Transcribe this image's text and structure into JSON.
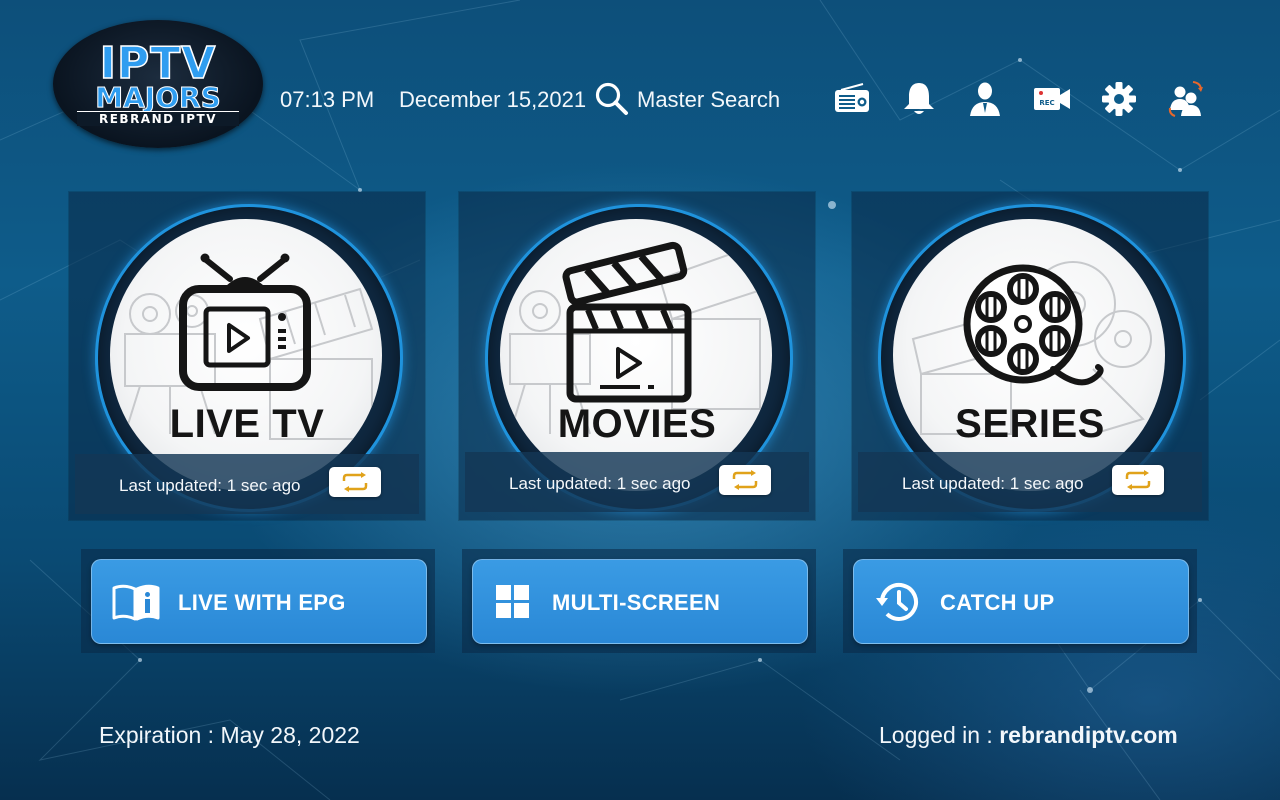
{
  "brand": {
    "line1": "IPTV",
    "line2": "MAJORS",
    "line3": "REBRAND IPTV"
  },
  "header": {
    "time": "07:13 PM",
    "date": "December 15,2021",
    "search_label": "Master Search",
    "icons": [
      "radio-icon",
      "bell-icon",
      "user-icon",
      "record-camera-icon",
      "gear-icon",
      "switch-user-icon"
    ]
  },
  "cards": [
    {
      "title": "LIVE TV",
      "updated": "Last updated: 1 sec ago"
    },
    {
      "title": "MOVIES",
      "updated": "Last updated: 1 sec ago"
    },
    {
      "title": "SERIES",
      "updated": "Last updated: 1 sec ago"
    }
  ],
  "actions": [
    {
      "label": "LIVE WITH EPG",
      "icon": "book-info-icon"
    },
    {
      "label": "MULTI-SCREEN",
      "icon": "grid-icon"
    },
    {
      "label": "CATCH UP",
      "icon": "history-icon"
    }
  ],
  "footer": {
    "expiration": "Expiration : May 28, 2022",
    "login_label": "Logged in : ",
    "login_value": "rebrandiptv.com"
  },
  "colors": {
    "accent": "#2a88d6",
    "ring": "#1f93dd",
    "refresh_arrow": "#e0a21a"
  }
}
